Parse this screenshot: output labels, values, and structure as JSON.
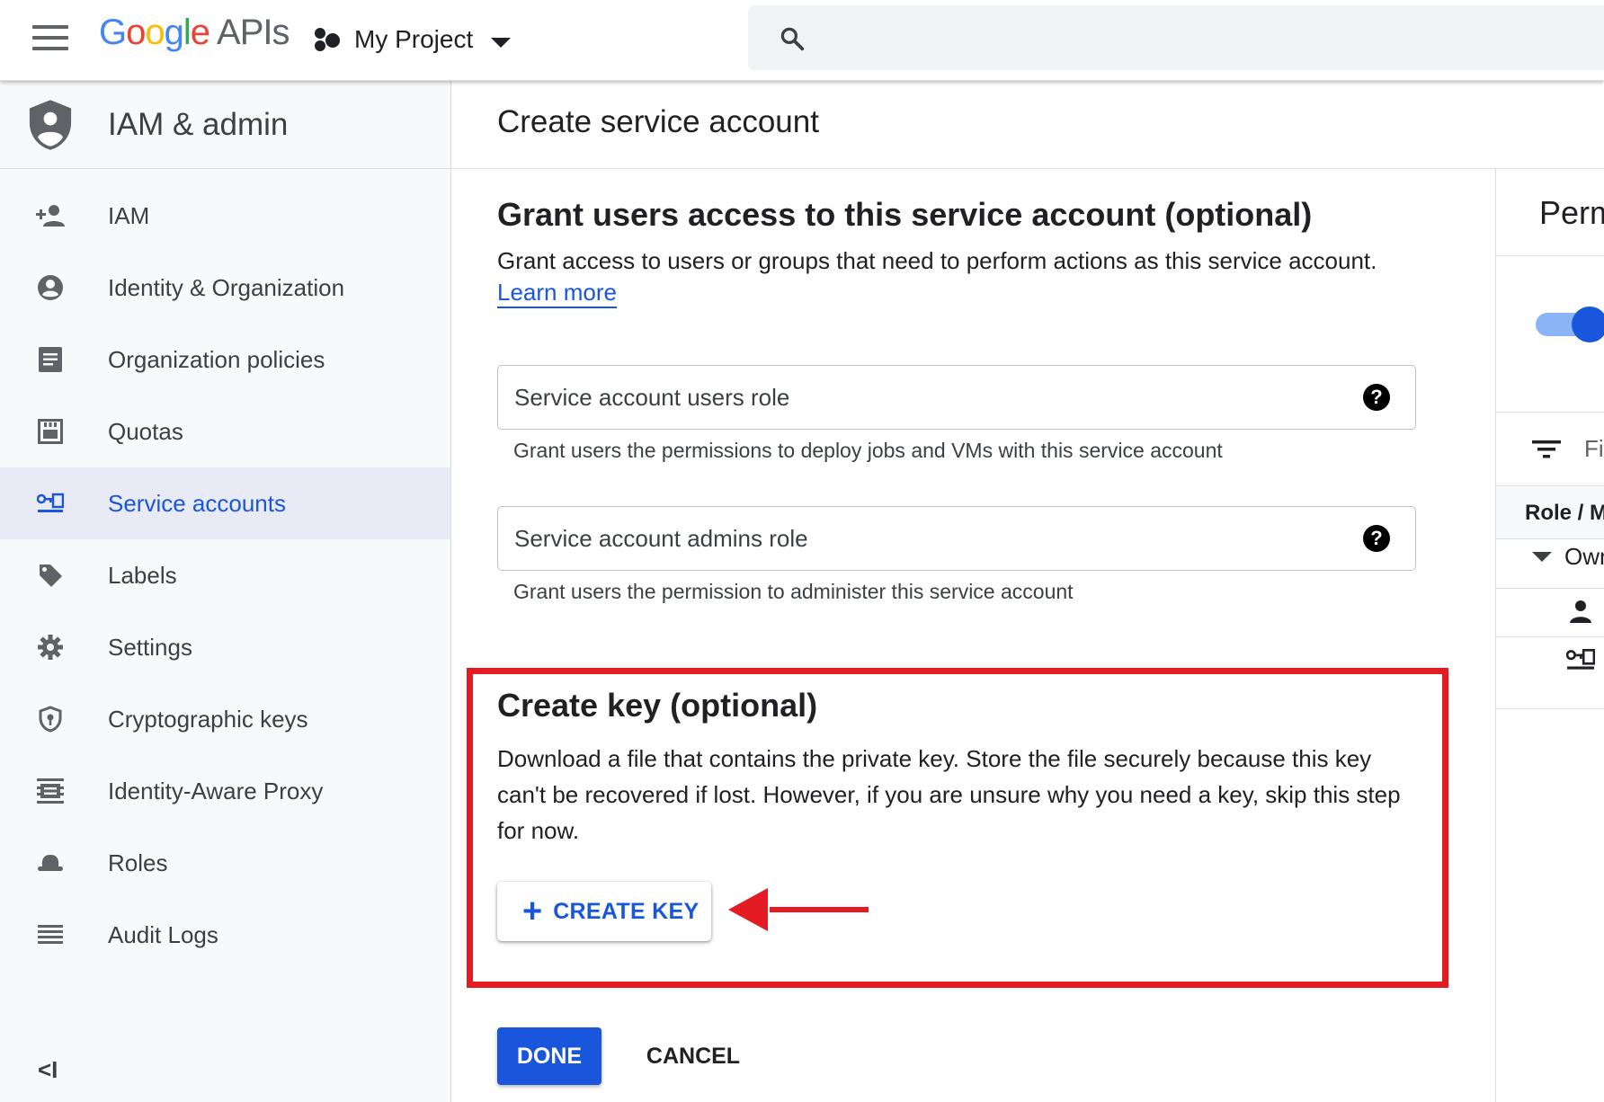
{
  "header": {
    "logo_word": [
      "G",
      "o",
      "o",
      "g",
      "l",
      "e"
    ],
    "logo_suffix": "APIs",
    "project_name": "My Project"
  },
  "sidebar": {
    "title": "IAM & admin",
    "items": [
      {
        "label": "IAM",
        "icon": "person-add-icon",
        "active": false
      },
      {
        "label": "Identity & Organization",
        "icon": "account-circle-icon",
        "active": false
      },
      {
        "label": "Organization policies",
        "icon": "document-icon",
        "active": false
      },
      {
        "label": "Quotas",
        "icon": "quota-icon",
        "active": false
      },
      {
        "label": "Service accounts",
        "icon": "service-account-key-icon",
        "active": true
      },
      {
        "label": "Labels",
        "icon": "tag-icon",
        "active": false
      },
      {
        "label": "Settings",
        "icon": "gear-icon",
        "active": false
      },
      {
        "label": "Cryptographic keys",
        "icon": "shield-key-icon",
        "active": false
      },
      {
        "label": "Identity-Aware Proxy",
        "icon": "proxy-icon",
        "active": false
      },
      {
        "label": "Roles",
        "icon": "hat-icon",
        "active": false
      },
      {
        "label": "Audit Logs",
        "icon": "list-icon",
        "active": false
      }
    ],
    "collapse_label": "<I"
  },
  "main": {
    "page_title": "Create service account",
    "grant": {
      "heading": "Grant users access to this service account (optional)",
      "description": "Grant access to users or groups that need to perform actions as this service account.",
      "learn_more": "Learn more",
      "users_role": {
        "placeholder": "Service account users role",
        "hint": "Grant users the permissions to deploy jobs and VMs with this service account"
      },
      "admins_role": {
        "placeholder": "Service account admins role",
        "hint": "Grant users the permission to administer this service account"
      }
    },
    "create_key": {
      "heading": "Create key (optional)",
      "line1": "Download a file that contains the private key. Store the file securely because this key",
      "line2": "can't be recovered if lost. However, if you are unsure why you need a key, skip this step",
      "line3": "for now.",
      "button_label": "CREATE KEY"
    },
    "actions": {
      "done": "DONE",
      "cancel": "CANCEL"
    }
  },
  "right_panel": {
    "title": "Perm",
    "filter_text": "Fi",
    "column_header": "Role / M",
    "row_label": "Own"
  },
  "colors": {
    "accent": "#1a56db",
    "highlight_box": "#e41b23",
    "active_nav_bg": "#e8eaf6"
  }
}
